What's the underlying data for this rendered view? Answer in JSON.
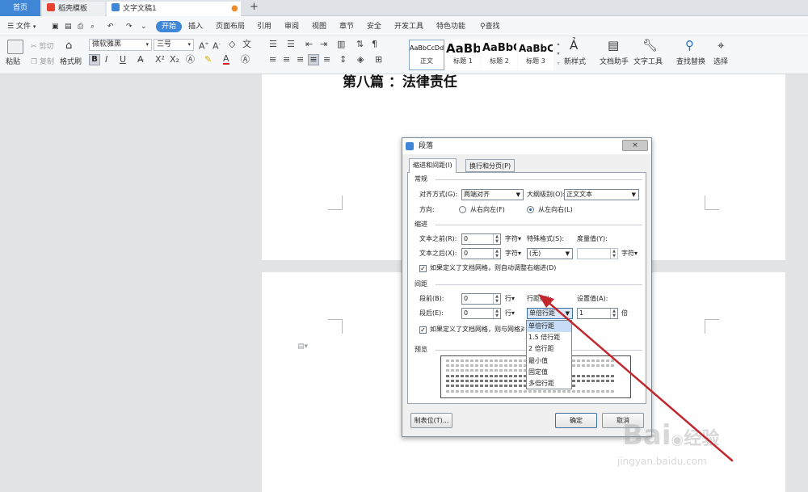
{
  "tabs": {
    "home": "首页",
    "template": "稻壳模板",
    "doc": "文字文稿1",
    "add": "+"
  },
  "menubar": {
    "file": "文件",
    "items": [
      "开始",
      "插入",
      "页面布局",
      "引用",
      "审阅",
      "视图",
      "章节",
      "安全",
      "开发工具",
      "特色功能"
    ],
    "search": "查找"
  },
  "ribbon": {
    "paste": "粘贴",
    "cut": "剪切",
    "copy": "复制",
    "format_painter": "格式刷",
    "font_name": "微软雅黑",
    "font_size": "三号",
    "styles": [
      {
        "preview": "AaBbCcDd",
        "name": "正文"
      },
      {
        "preview": "AaBb",
        "name": "标题 1"
      },
      {
        "preview": "AaBbC",
        "name": "标题 2"
      },
      {
        "preview": "AaBbC",
        "name": "标题 3"
      }
    ],
    "new_style": "新样式",
    "doc_assistant": "文档助手",
    "text_tools": "文字工具",
    "find_replace": "查找替换",
    "select": "选择"
  },
  "document": {
    "heading": "第八篇 ：法律责任"
  },
  "dialog": {
    "title": "段落",
    "close": "×",
    "tabs": [
      "缩进和间距(I)",
      "换行和分页(P)"
    ],
    "general": {
      "section": "常规",
      "align_label": "对齐方式(G):",
      "align_value": "两端对齐",
      "outline_label": "大纲级别(O):",
      "outline_value": "正文文本",
      "direction_label": "方向:",
      "rtl": "从右向左(F)",
      "ltr": "从左向右(L)"
    },
    "indent": {
      "section": "缩进",
      "before_label": "文本之前(R):",
      "before_value": "0",
      "before_unit": "字符",
      "after_label": "文本之后(X):",
      "after_value": "0",
      "after_unit": "字符",
      "special_label": "特殊格式(S):",
      "special_value": "(无)",
      "measure_label": "度量值(Y):",
      "measure_unit": "字符",
      "grid_check": "如果定义了文档网格，则自动调整右缩进(D)"
    },
    "spacing": {
      "section": "间距",
      "before_label": "段前(B):",
      "before_value": "0",
      "before_unit": "行",
      "after_label": "段后(E):",
      "after_value": "0",
      "after_unit": "行",
      "line_label": "行距(N):",
      "line_value": "单倍行距",
      "set_label": "设置值(A):",
      "set_value": "1",
      "set_unit": "倍",
      "grid_check": "如果定义了文档网格，则与网格对齐"
    },
    "line_options": [
      "单倍行距",
      "1.5 倍行距",
      "2 倍行距",
      "最小值",
      "固定值",
      "多倍行距"
    ],
    "preview": {
      "section": "预览"
    },
    "tabs_button": "制表位(T)...",
    "ok": "确定",
    "cancel": "取消"
  },
  "watermark": {
    "brand": "Bai",
    "sub": "jingyan.baidu.com",
    "cn": "经验"
  },
  "colors": {
    "accent": "#3f86d6",
    "arrow": "#c1272d"
  }
}
